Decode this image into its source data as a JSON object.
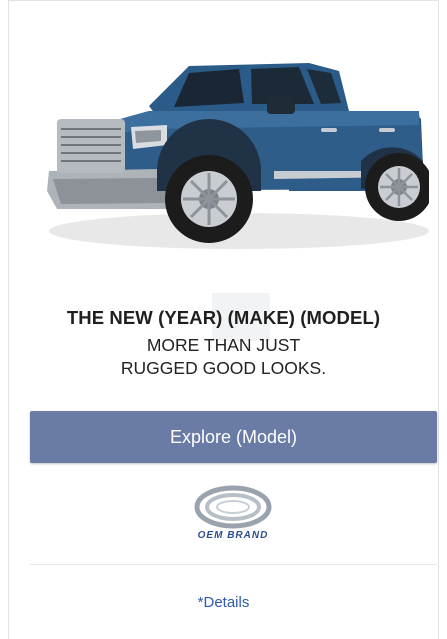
{
  "card": {
    "headline": "THE NEW (YEAR) (MAKE) (MODEL)",
    "tagline_line1": "MORE THAN JUST",
    "tagline_line2": "RUGGED GOOD LOOKS.",
    "cta_label": "Explore (Model)",
    "brand_logo_text": "OEM BRAND",
    "details_link": "*Details"
  },
  "colors": {
    "button_bg": "#6a7ba6",
    "truck_body": "#2f5d8a",
    "link": "#2f5aa8",
    "logo": "#2d4f8e"
  },
  "icons": {
    "vehicle_image": "pickup-truck-image",
    "brand_logo": "oem-brand-logo"
  }
}
